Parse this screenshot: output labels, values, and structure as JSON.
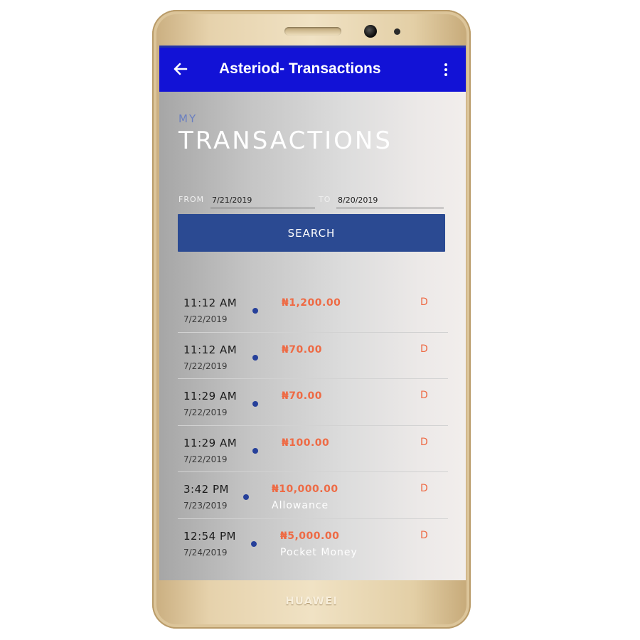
{
  "device": {
    "brand": "HUAWEI"
  },
  "appbar": {
    "title": "Asteriod- Transactions",
    "back_icon": "arrow-left-icon",
    "menu_icon": "more-vertical-icon",
    "color": "#1212d6"
  },
  "header": {
    "prefix": "MY",
    "title": "TRANSACTIONS"
  },
  "filter": {
    "from_label": "FROM",
    "from_value": "7/21/2019",
    "to_label": "TO",
    "to_value": "8/20/2019",
    "search_label": "SEARCH",
    "search_color": "#2b4a92"
  },
  "transactions": [
    {
      "time": "11:12 AM",
      "date": "7/22/2019",
      "amount": "₦1,200.00",
      "type": "D",
      "description": ""
    },
    {
      "time": "11:12 AM",
      "date": "7/22/2019",
      "amount": "₦70.00",
      "type": "D",
      "description": ""
    },
    {
      "time": "11:29 AM",
      "date": "7/22/2019",
      "amount": "₦70.00",
      "type": "D",
      "description": ""
    },
    {
      "time": "11:29 AM",
      "date": "7/22/2019",
      "amount": "₦100.00",
      "type": "D",
      "description": ""
    },
    {
      "time": "3:42 PM",
      "date": "7/23/2019",
      "amount": "₦10,000.00",
      "type": "D",
      "description": "Allowance"
    },
    {
      "time": "12:54 PM",
      "date": "7/24/2019",
      "amount": "₦5,000.00",
      "type": "D",
      "description": "Pocket Money"
    }
  ],
  "colors": {
    "amount": "#ee6a44",
    "dot": "#26409a"
  }
}
